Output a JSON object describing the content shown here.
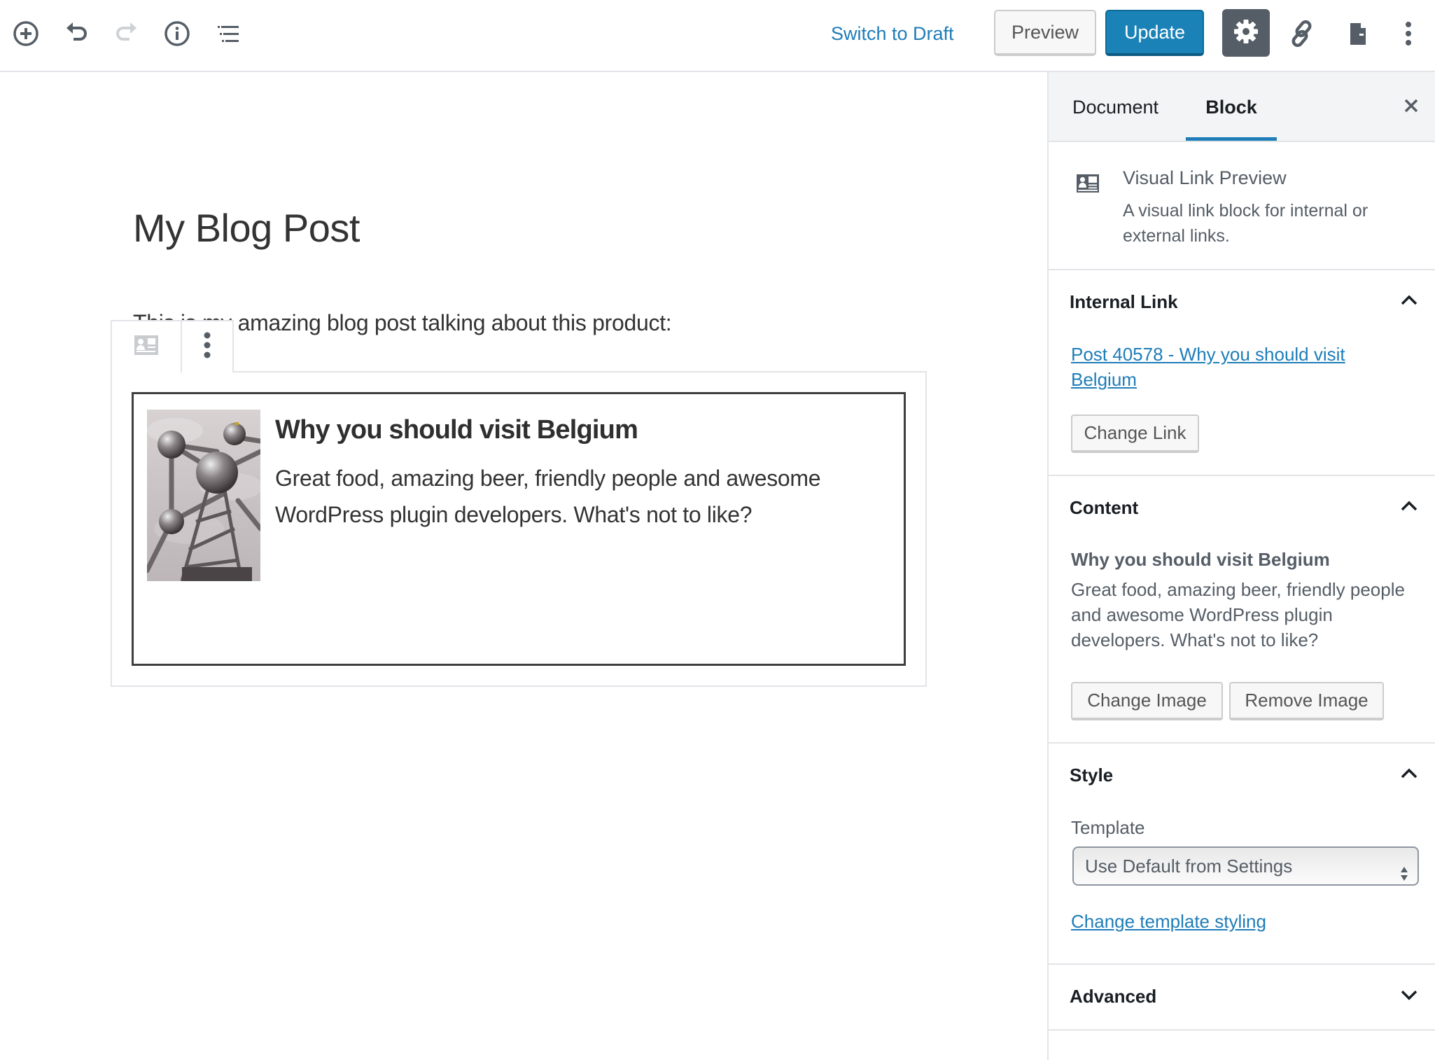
{
  "header": {
    "icons": {
      "add": "add-block-icon",
      "undo": "undo-icon",
      "redo": "redo-icon",
      "info": "info-icon",
      "outline": "block-navigation-icon",
      "settings": "gear-icon",
      "link": "link-icon",
      "document": "document-icon",
      "more": "more-vertical-icon"
    },
    "switch_to_draft": "Switch to Draft",
    "preview": "Preview",
    "update": "Update"
  },
  "editor": {
    "post_title": "My Blog Post",
    "paragraph": "This is my amazing blog post talking about this product:",
    "block_toolbar": {
      "block_type_icon": "visual-link-preview-icon",
      "more_icon": "more-vertical-icon"
    },
    "card": {
      "image_alt": "Atomium in Brussels",
      "title": "Why you should visit Belgium",
      "description": "Great food, amazing beer, friendly people and awesome WordPress plugin developers. What's not to like?"
    }
  },
  "sidebar": {
    "tabs": [
      {
        "label": "Document",
        "active": false
      },
      {
        "label": "Block",
        "active": true
      }
    ],
    "close_icon": "close-icon",
    "block_card": {
      "title": "Visual Link Preview",
      "description": "A visual link block for internal or external links."
    },
    "panels": {
      "internal_link": {
        "title": "Internal Link",
        "expanded": true,
        "link_text": "Post 40578 - Why you should visit Belgium",
        "change_link": "Change Link"
      },
      "content": {
        "title": "Content",
        "expanded": true,
        "content_title": "Why you should visit Belgium",
        "content_description": "Great food, amazing beer, friendly people and awesome WordPress plugin developers. What's not to like?",
        "change_image": "Change Image",
        "remove_image": "Remove Image"
      },
      "style": {
        "title": "Style",
        "expanded": true,
        "template_label": "Template",
        "template_value": "Use Default from Settings",
        "change_template_styling": "Change template styling"
      },
      "advanced": {
        "title": "Advanced",
        "expanded": false
      }
    }
  },
  "colors": {
    "accent": "#1e7db8",
    "update_button": "#1a82b7",
    "settings_active": "#555d66",
    "border": "#e2e4e7",
    "card_border": "#3f3f3f"
  }
}
